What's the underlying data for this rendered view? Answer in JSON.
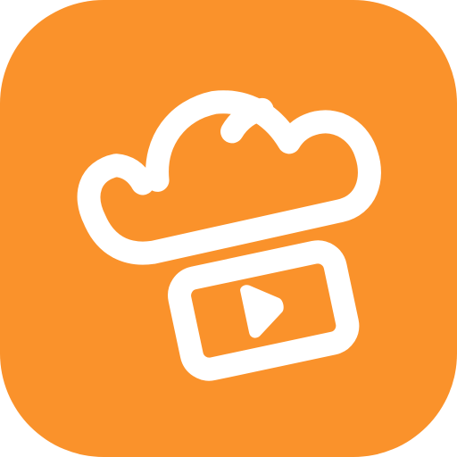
{
  "icon": {
    "name": "cloud-video-app-icon",
    "colors": {
      "background": "#FA922B",
      "foreground": "#FFFFFF"
    },
    "glyphs": [
      "cloud-icon",
      "video-frame-icon",
      "play-icon"
    ]
  }
}
